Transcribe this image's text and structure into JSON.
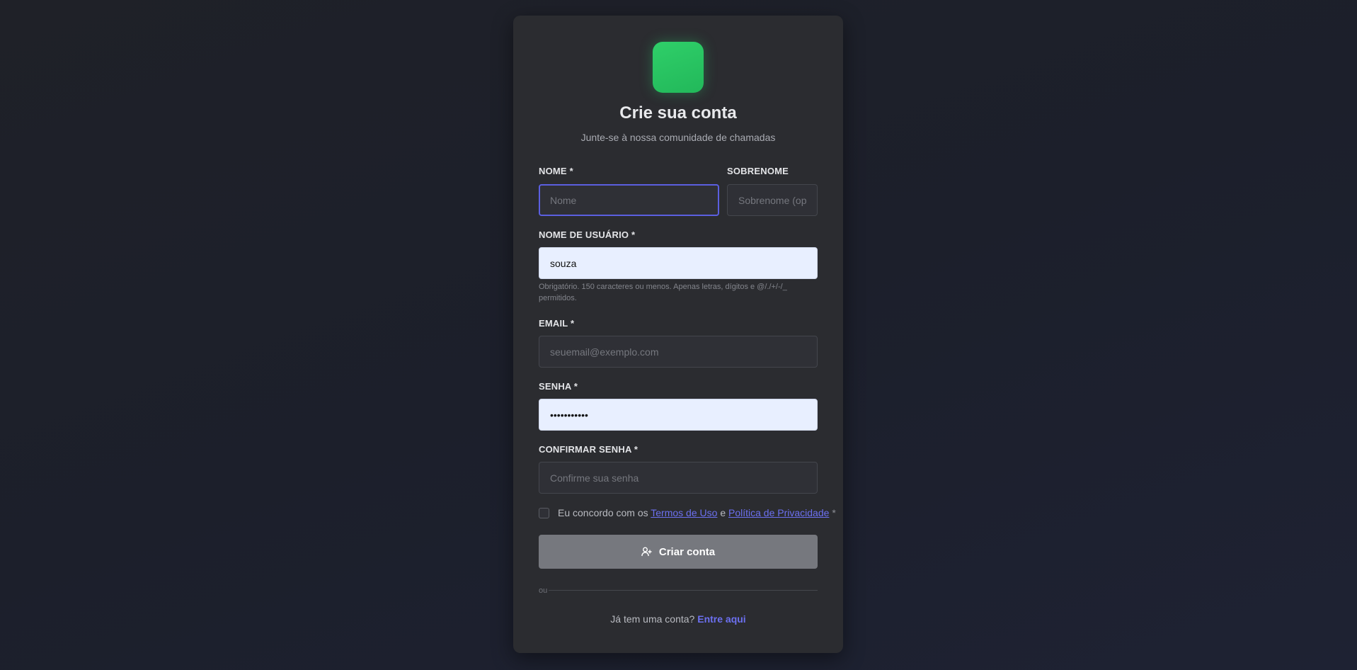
{
  "header": {
    "title": "Crie sua conta",
    "subtitle": "Junte-se à nossa comunidade de chamadas"
  },
  "form": {
    "first_name": {
      "label": "NOME *",
      "placeholder": "Nome",
      "value": ""
    },
    "last_name": {
      "label": "SOBRENOME",
      "placeholder": "Sobrenome (opcional)",
      "value": ""
    },
    "username": {
      "label": "NOME DE USUÁRIO *",
      "value": "souza",
      "help": "Obrigatório. 150 caracteres ou menos. Apenas letras, dígitos e @/./+/-/_ permitidos."
    },
    "email": {
      "label": "EMAIL *",
      "placeholder": "seuemail@exemplo.com",
      "value": ""
    },
    "password": {
      "label": "SENHA *",
      "value": "•••••••••••"
    },
    "confirm_password": {
      "label": "CONFIRMAR SENHA *",
      "placeholder": "Confirme sua senha",
      "value": ""
    },
    "terms": {
      "prefix": "Eu concordo com os",
      "terms_link": "Termos de Uso",
      "conjunction": "e",
      "privacy_link": "Política de Privacidade",
      "required_mark": "*",
      "checked": false
    },
    "submit_label": "Criar conta",
    "submit_icon": "user-plus-icon"
  },
  "divider_text": "ou",
  "footer": {
    "prompt": "Já tem uma conta?",
    "link": "Entre aqui"
  },
  "colors": {
    "accent": "#5b5fe0",
    "link": "#6c70f0",
    "logo": "#2fcf69",
    "card_bg": "#2b2c30",
    "submit_bg": "#76787e"
  }
}
